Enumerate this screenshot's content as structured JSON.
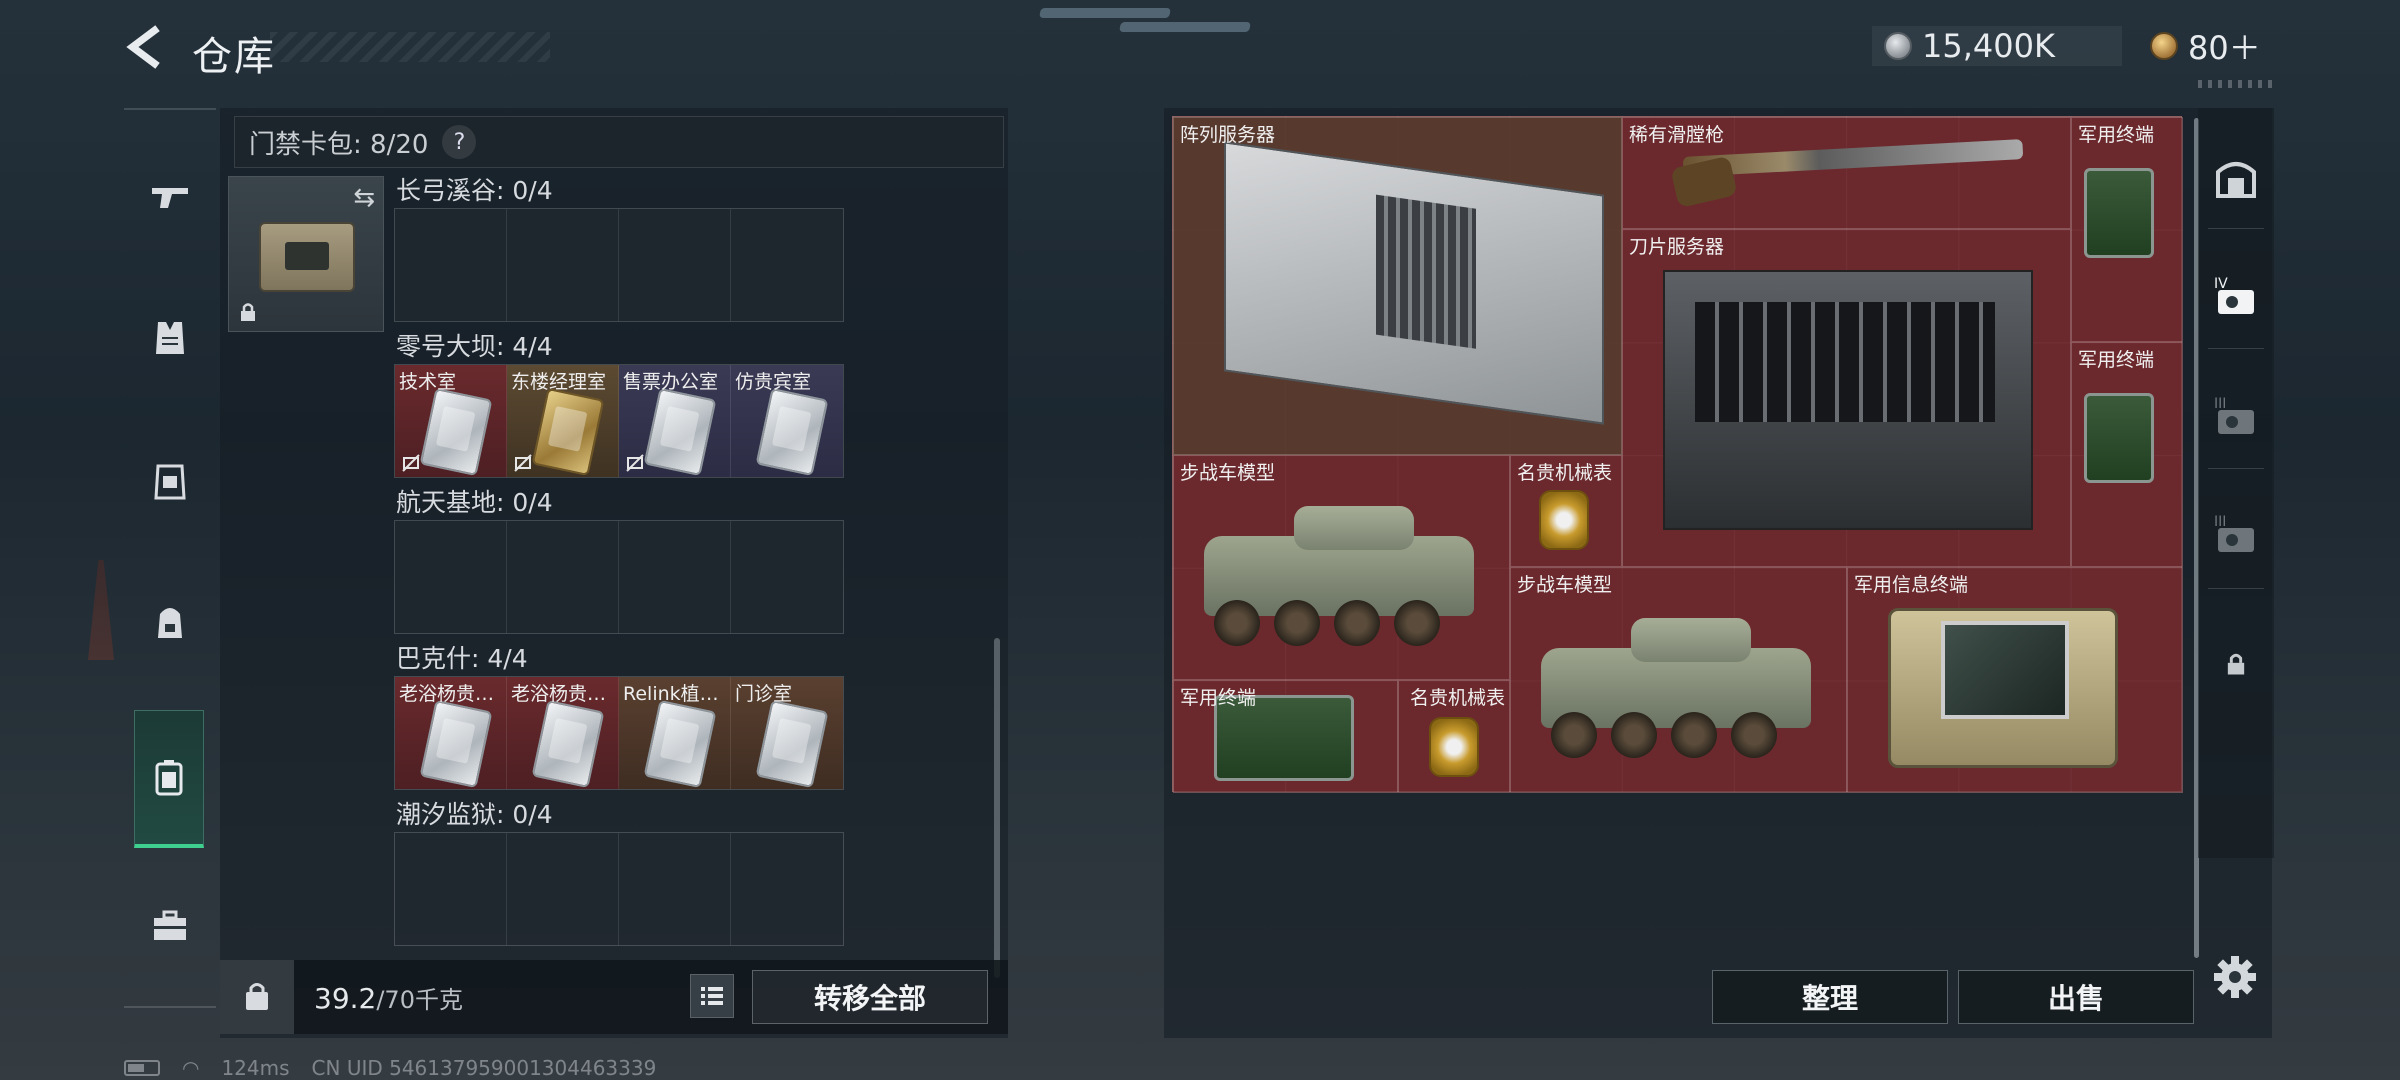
{
  "header": {
    "title": "仓库",
    "currency_silver": "15,400K",
    "currency_gold": "80＋"
  },
  "left_rail": {
    "items": [
      {
        "icon": "gun-icon"
      },
      {
        "icon": "armor-vest-icon"
      },
      {
        "icon": "chest-rig-icon"
      },
      {
        "icon": "backpack-icon"
      },
      {
        "icon": "keycard-case-icon",
        "active": true
      },
      {
        "icon": "toolbox-icon"
      }
    ]
  },
  "keycard_pack": {
    "label": "门禁卡包: 8/20",
    "help": "?",
    "swap_symbol": "⇆"
  },
  "zones": [
    {
      "title": "长弓溪谷: 0/4",
      "slots": []
    },
    {
      "title": "零号大坝: 4/4",
      "slots": [
        {
          "label": "技术室",
          "color": "red"
        },
        {
          "label": "东楼经理室",
          "color": "red",
          "card": "gold"
        },
        {
          "label": "售票办公室",
          "color": "purple"
        },
        {
          "label": "仿贵宾室",
          "color": "purple"
        }
      ]
    },
    {
      "title": "航天基地: 0/4",
      "slots": []
    },
    {
      "title": "巴克什: 4/4",
      "slots": [
        {
          "label": "老浴杨贵…",
          "color": "red"
        },
        {
          "label": "老浴杨贵…",
          "color": "red"
        },
        {
          "label": "Relink植…",
          "color": "brown"
        },
        {
          "label": "门诊室",
          "color": "brown"
        }
      ]
    },
    {
      "title": "潮汐监狱: 0/4",
      "slots": []
    }
  ],
  "bottom": {
    "weight_value": "39.2",
    "weight_max": "/70千克",
    "transfer_all": "转移全部"
  },
  "stash_items": [
    {
      "label": "阵列服务器"
    },
    {
      "label": "稀有滑膛枪"
    },
    {
      "label": "军用终端"
    },
    {
      "label": "刀片服务器"
    },
    {
      "label": "军用终端"
    },
    {
      "label": "步战车模型"
    },
    {
      "label": "名贵机械表"
    },
    {
      "label": "步战车模型"
    },
    {
      "label": "军用信息终端"
    },
    {
      "label": "军用终端"
    },
    {
      "label": "名贵机械表"
    }
  ],
  "right_actions": {
    "sort": "整理",
    "sell": "出售"
  },
  "right_rail": {
    "items": [
      {
        "icon": "safe-box-icon"
      },
      {
        "icon": "keycard-level-4-icon"
      },
      {
        "icon": "keycard-level-3-icon"
      },
      {
        "icon": "keycard-level-3-alt-icon"
      },
      {
        "icon": "lock-icon"
      }
    ]
  },
  "status": {
    "ping": "124ms",
    "uid": "CN UID 546137959001304463339"
  }
}
